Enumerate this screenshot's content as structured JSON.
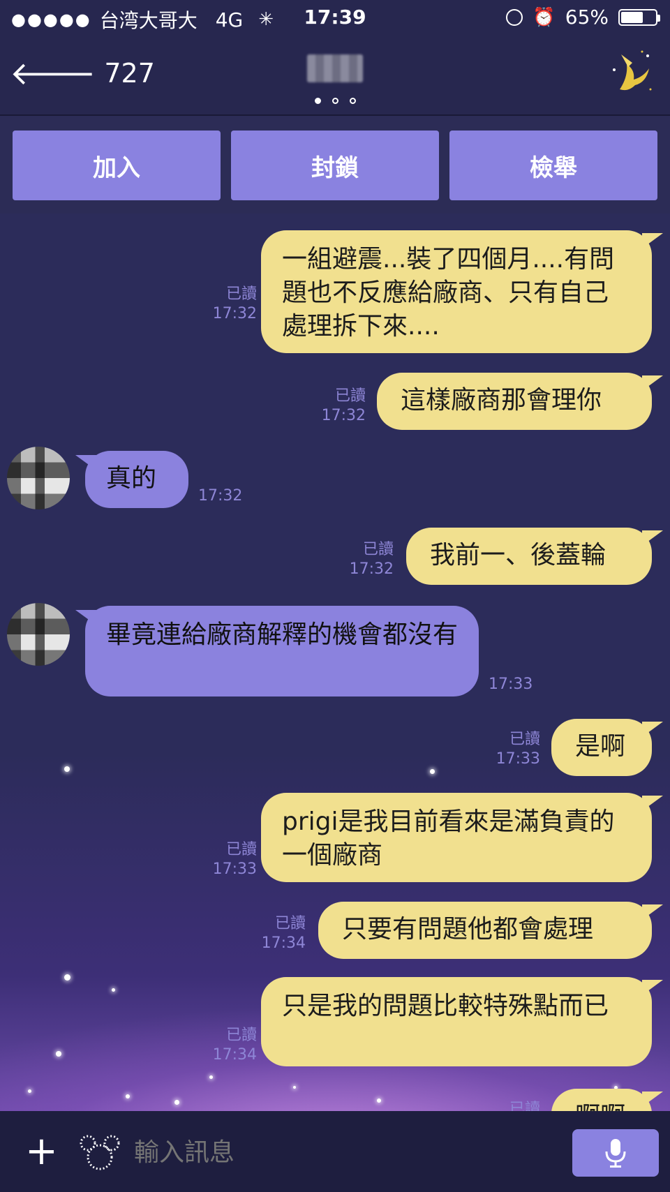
{
  "status_bar": {
    "signal": "●●●●●",
    "carrier": "台湾大哥大",
    "network": "4G",
    "time": "17:39",
    "battery": "65%",
    "battery_level": 0.65
  },
  "nav": {
    "back_count": "727"
  },
  "actions": {
    "add": "加入",
    "block": "封鎖",
    "report": "檢舉"
  },
  "messages": [
    {
      "dir": "out",
      "text": "一組避震...裝了四個月....有問題也不反應給廠商、只有自己處理拆下來....",
      "read": "已讀",
      "time": "17:32"
    },
    {
      "dir": "out",
      "text": "這樣廠商那會理你",
      "read": "已讀",
      "time": "17:32"
    },
    {
      "dir": "in",
      "text": "真的",
      "time": "17:32"
    },
    {
      "dir": "out",
      "text": "我前一、後蓋輪",
      "read": "已讀",
      "time": "17:32"
    },
    {
      "dir": "in",
      "text": "畢竟連給廠商解釋的機會都沒有",
      "time": "17:33"
    },
    {
      "dir": "out",
      "text": "是啊",
      "read": "已讀",
      "time": "17:33"
    },
    {
      "dir": "out",
      "text": "prigi是我目前看來是滿負責的一個廠商",
      "read": "已讀",
      "time": "17:33"
    },
    {
      "dir": "out",
      "text": "只要有問題他都會處理",
      "read": "已讀",
      "time": "17:34"
    },
    {
      "dir": "out",
      "text": "只是我的問題比較特殊點而已",
      "read": "已讀",
      "time": "17:34"
    },
    {
      "dir": "out",
      "text": "啊啊",
      "read": "已讀",
      "time": ""
    }
  ],
  "input": {
    "placeholder": "輸入訊息"
  },
  "colors": {
    "background": "#2a2a55",
    "button": "#8a82e0",
    "outgoing_bubble": "#f1e08f",
    "incoming_bubble": "#8b82de",
    "meta_text": "#8e86d6"
  },
  "icons": [
    "back-arrow-icon",
    "rotation-lock-icon",
    "alarm-icon",
    "battery-icon",
    "fairy-icon",
    "plus-icon",
    "mickey-sticker-icon",
    "microphone-icon"
  ]
}
